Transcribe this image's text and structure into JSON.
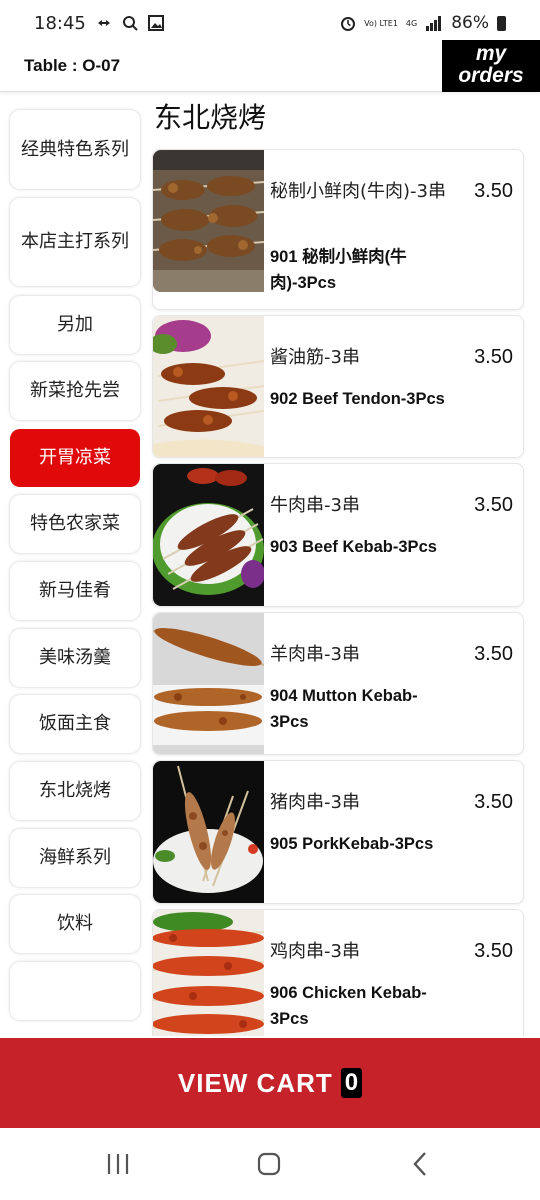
{
  "status_bar": {
    "time": "18:45",
    "net_label": "Vo) LTE1",
    "net_type": "4G",
    "battery": "86%"
  },
  "header": {
    "table": "Table : O-07",
    "my_orders_line1": "my",
    "my_orders_line2": "orders"
  },
  "categories": [
    {
      "label": "经典特色系列"
    },
    {
      "label": "本店主打系列"
    },
    {
      "label": "另加"
    },
    {
      "label": "新菜抢先尝"
    },
    {
      "label": "开胃凉菜",
      "active": true
    },
    {
      "label": "特色农家菜"
    },
    {
      "label": "新马佳肴"
    },
    {
      "label": "美味汤羹"
    },
    {
      "label": "饭面主食"
    },
    {
      "label": "东北烧烤"
    },
    {
      "label": "海鲜系列"
    },
    {
      "label": "饮料"
    }
  ],
  "section": {
    "title": "东北烧烤"
  },
  "items": [
    {
      "name": "秘制小鲜肉(牛肉)-3串",
      "price": "3.50",
      "desc": "901 秘制小鲜肉(牛肉)-3Pcs"
    },
    {
      "name": "酱油筋-3串",
      "price": "3.50",
      "desc": "902 Beef Tendon-3Pcs"
    },
    {
      "name": "牛肉串-3串",
      "price": "3.50",
      "desc": "903 Beef Kebab-3Pcs"
    },
    {
      "name": "羊肉串-3串",
      "price": "3.50",
      "desc": "904 Mutton Kebab-3Pcs"
    },
    {
      "name": "猪肉串-3串",
      "price": "3.50",
      "desc": "905 PorkKebab-3Pcs"
    },
    {
      "name": "鸡肉串-3串",
      "price": "3.50",
      "desc": "906 Chicken Kebab-3Pcs"
    }
  ],
  "cart": {
    "label": "VIEW CART",
    "count": "0"
  },
  "colors": {
    "accent_red": "#e00a0a",
    "cart_bg": "#c5222a"
  },
  "icons": {
    "nav": [
      "recent-apps-icon",
      "home-icon",
      "back-icon"
    ]
  }
}
